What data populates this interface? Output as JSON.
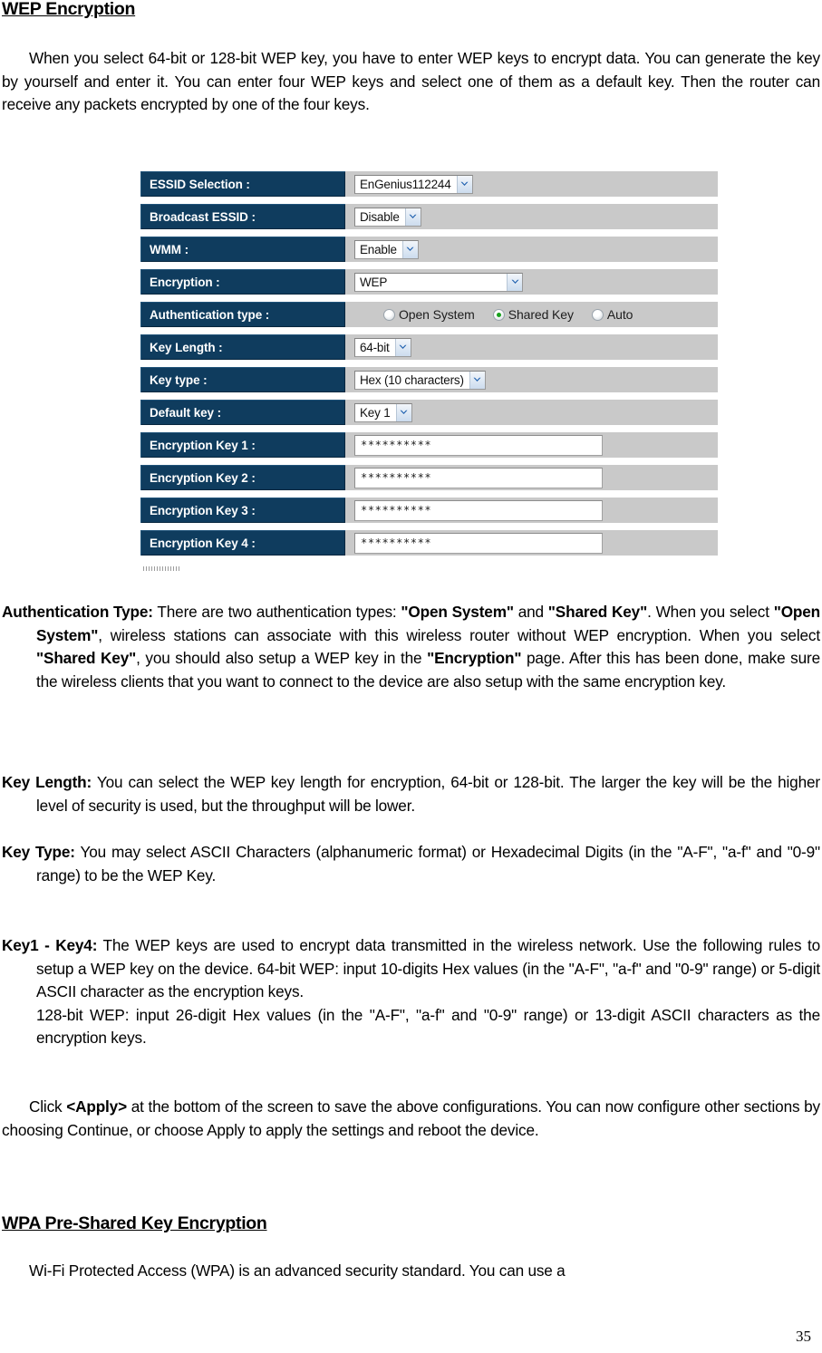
{
  "document": {
    "page_number": "35"
  },
  "headings": {
    "wep": "WEP Encryption",
    "wpa": "WPA Pre-Shared Key Encryption"
  },
  "intro_paragraph": "When you select 64-bit or 128-bit WEP key, you have to enter WEP keys to encrypt data. You can generate the key by yourself and enter it. You can enter four WEP keys and select one of them as a default key. Then the router can receive any packets encrypted by one of the four keys.",
  "config_screenshot": {
    "rows": [
      {
        "label": "ESSID Selection :",
        "control": "select",
        "value": "EnGenius112244"
      },
      {
        "label": "Broadcast ESSID :",
        "control": "select",
        "value": "Disable"
      },
      {
        "label": "WMM :",
        "control": "select",
        "value": "Enable"
      },
      {
        "label": "Encryption :",
        "control": "select-wide",
        "value": "WEP"
      },
      {
        "label": "Authentication type :",
        "control": "radio",
        "value": "Shared Key"
      },
      {
        "label": "Key Length :",
        "control": "select",
        "value": "64-bit"
      },
      {
        "label": "Key type :",
        "control": "select",
        "value": "Hex (10 characters)"
      },
      {
        "label": "Default key :",
        "control": "select",
        "value": "Key 1"
      },
      {
        "label": "Encryption Key 1 :",
        "control": "text",
        "value": "**********"
      },
      {
        "label": "Encryption Key 2 :",
        "control": "text",
        "value": "**********"
      },
      {
        "label": "Encryption Key 3 :",
        "control": "text",
        "value": "**********"
      },
      {
        "label": "Encryption Key 4 :",
        "control": "text",
        "value": "**********"
      }
    ],
    "auth_options": [
      {
        "label": "Open System",
        "selected": false
      },
      {
        "label": "Shared Key",
        "selected": true
      },
      {
        "label": "Auto",
        "selected": false
      }
    ],
    "colors": {
      "label_cell": "#0f3c5e",
      "value_cell": "#c9c9c9",
      "radio_selected_dot": "#19a11e"
    }
  },
  "definitions": {
    "auth_type": {
      "term": "Authentication Type:",
      "text_1": " There are two authentication types: ",
      "bold_1": "\"Open System\"",
      "text_2": " and ",
      "bold_2": "\"Shared Key\"",
      "text_3": ". When you select ",
      "bold_3": "\"Open System\"",
      "text_4": ", wireless stations can associate with this wireless router without WEP encryption. When you select ",
      "bold_4": "\"Shared Key\"",
      "text_5": ", you should also setup a WEP key in the ",
      "bold_5": "\"Encryption\"",
      "text_6": " page. After this has been done, make sure the wireless clients that you want to connect to the device are also setup with the same encryption key."
    },
    "key_length": {
      "term": "Key Length:",
      "text": " You can select the WEP key length for encryption, 64-bit or 128-bit. The larger the key will be the higher level of security is used, but the throughput will be lower."
    },
    "key_type": {
      "term": "Key Type:",
      "text": " You may select ASCII Characters (alphanumeric format) or Hexadecimal Digits (in the \"A-F\", \"a-f\" and \"0-9\" range) to be the WEP Key."
    },
    "key1_key4": {
      "term": "Key1 - Key4:",
      "text_line_1": " The WEP keys are used to encrypt data transmitted in the wireless network. Use the following rules to setup a WEP key on the device. 64-bit WEP: input 10-digits Hex values (in the \"A-F\", \"a-f\" and \"0-9\" range) or 5-digit ASCII character as the encryption keys.",
      "text_line_2": "128-bit WEP: input 26-digit Hex values (in the \"A-F\", \"a-f\" and \"0-9\" range) or 13-digit ASCII characters as the encryption keys."
    }
  },
  "apply_paragraph": {
    "text_1": "Click ",
    "bold_1": "<Apply>",
    "text_2": " at the bottom of the screen to save the above configurations. You can now configure other sections by choosing Continue, or choose Apply to apply the settings and reboot the device."
  },
  "wpa_paragraph": "Wi-Fi Protected Access (WPA) is an advanced security standard. You can use a"
}
